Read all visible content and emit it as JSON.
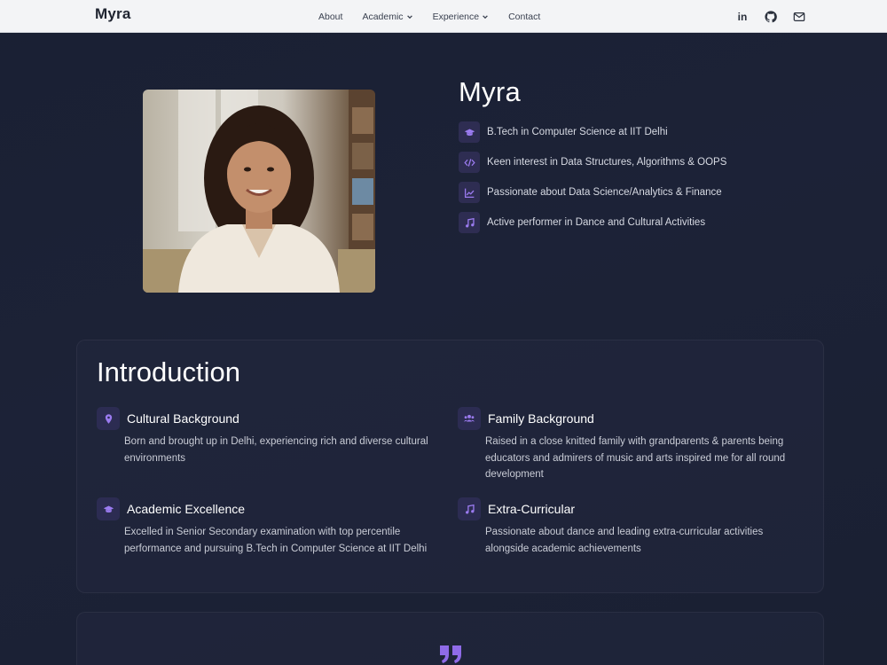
{
  "nav": {
    "brand": "Myra",
    "items": [
      {
        "label": "About",
        "has_dropdown": false
      },
      {
        "label": "Academic",
        "has_dropdown": true
      },
      {
        "label": "Experience",
        "has_dropdown": true
      },
      {
        "label": "Contact",
        "has_dropdown": false
      }
    ],
    "social": [
      "linkedin-icon",
      "github-icon",
      "mail-icon"
    ],
    "linkedin_text": "in"
  },
  "hero": {
    "name": "Myra",
    "photo": "portrait-photo",
    "highlights": [
      {
        "icon": "graduation-cap-icon",
        "text": "B.Tech in Computer Science at IIT Delhi"
      },
      {
        "icon": "code-icon",
        "text": "Keen interest in Data Structures, Algorithms & OOPS"
      },
      {
        "icon": "chart-line-icon",
        "text": "Passionate about Data Science/Analytics & Finance"
      },
      {
        "icon": "music-note-icon",
        "text": "Active performer in Dance and Cultural Activities"
      }
    ]
  },
  "intro": {
    "title": "Introduction",
    "features": [
      {
        "icon": "location-pin-icon",
        "title": "Cultural Background",
        "body": "Born and brought up in Delhi, experiencing rich and diverse cultural environments"
      },
      {
        "icon": "users-icon",
        "title": "Family Background",
        "body": "Raised in a close knitted family with grandparents & parents being educators and admirers of music and arts inspired me for all round development"
      },
      {
        "icon": "graduation-cap-icon",
        "title": "Academic Excellence",
        "body": "Excelled in Senior Secondary examination with top percentile performance and pursuing B.Tech in Computer Science at IIT Delhi"
      },
      {
        "icon": "music-note-icon",
        "title": "Extra-Curricular",
        "body": "Passionate about dance and leading extra-curricular activities alongside academic achievements"
      }
    ]
  },
  "colors": {
    "accent": "#9b7bf0",
    "background": "#1b2135",
    "nav_bg": "#f3f4f6"
  }
}
